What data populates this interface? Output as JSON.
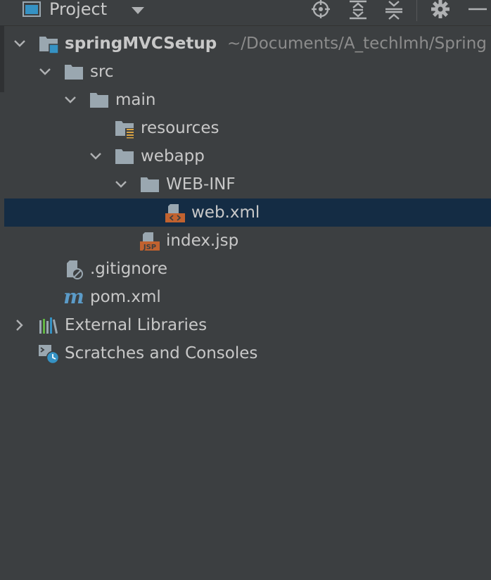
{
  "header": {
    "title": "Project",
    "icons": [
      "project-window-icon",
      "dropdown-arrow-icon",
      "locate-icon",
      "expand-all-icon",
      "collapse-all-icon",
      "gear-icon",
      "hide-icon"
    ]
  },
  "tree": {
    "root": {
      "label": "springMVCSetup",
      "path": "~/Documents/A_techlmh/Spring"
    },
    "src": "src",
    "main": "main",
    "resources": "resources",
    "webapp": "webapp",
    "webinf": "WEB-INF",
    "webxml": "web.xml",
    "indexjsp": "index.jsp",
    "gitignore": ".gitignore",
    "pomxml": "pom.xml",
    "external": "External Libraries",
    "scratches": "Scratches and Consoles"
  },
  "colors": {
    "background": "#3c3f41",
    "selection": "#142c44",
    "text": "#c8c8c8",
    "path_text": "#8c8c8c",
    "folder": "#9aa7b0",
    "xml_badge": "#c1622f",
    "module_badge": "#3592c4"
  }
}
